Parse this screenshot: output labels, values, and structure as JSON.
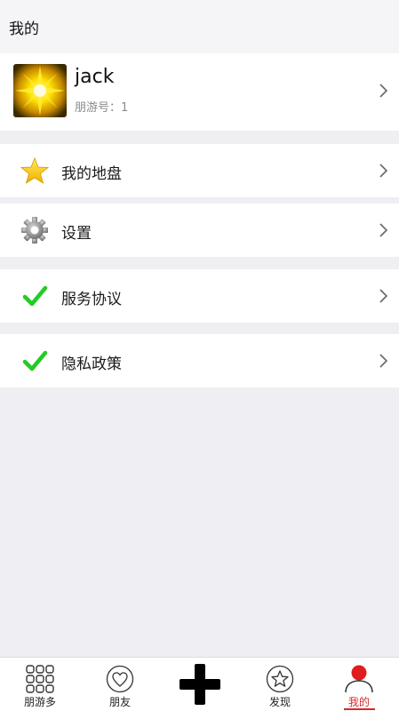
{
  "header": {
    "title": "我的"
  },
  "profile": {
    "name": "jack",
    "id_label": "朋游号：1"
  },
  "menu": [
    {
      "label": "我的地盘",
      "icon": "star-icon"
    },
    {
      "label": "设置",
      "icon": "gear-icon"
    },
    {
      "label": "服务协议",
      "icon": "checkmark-icon"
    },
    {
      "label": "隐私政策",
      "icon": "checkmark-icon"
    }
  ],
  "tabbar": [
    {
      "label": "朋游多",
      "icon": "grid-icon"
    },
    {
      "label": "朋友",
      "icon": "heart-icon"
    },
    {
      "label": "",
      "icon": "plus-icon"
    },
    {
      "label": "发现",
      "icon": "star-outline-icon"
    },
    {
      "label": "我的",
      "icon": "person-icon",
      "active": true
    }
  ],
  "colors": {
    "accent": "#d42a2a",
    "check": "#22cc22",
    "star": "#f5c400",
    "background": "#efeef3"
  }
}
